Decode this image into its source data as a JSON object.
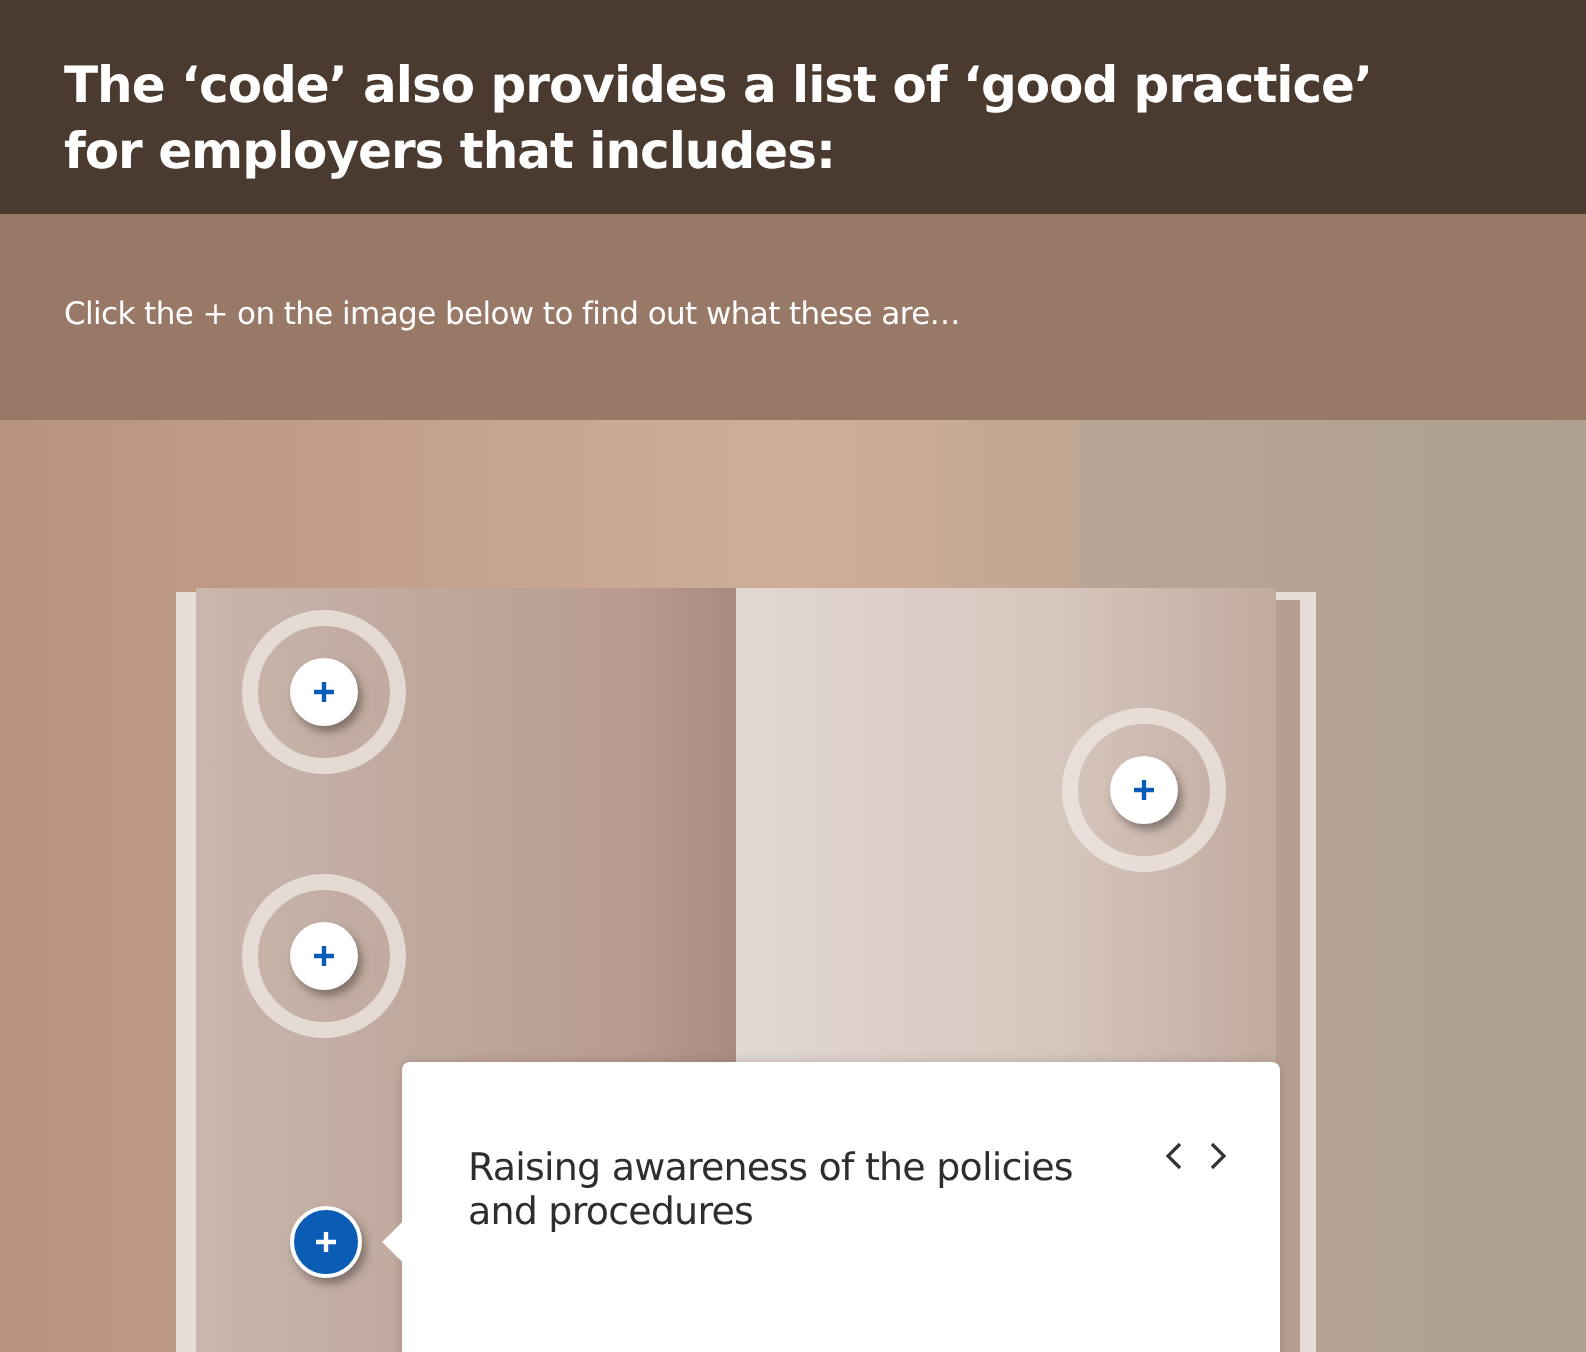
{
  "header": {
    "title": "The ‘code’ also provides a list of ‘good practice’ for employers that includes:"
  },
  "instruction": "Click the + on the image below to find out what these are…",
  "hotspots": [
    {
      "selected": false
    },
    {
      "selected": false
    },
    {
      "selected": false
    },
    {
      "selected": true
    }
  ],
  "popup": {
    "title": "Raising awareness of the policies and procedures"
  }
}
